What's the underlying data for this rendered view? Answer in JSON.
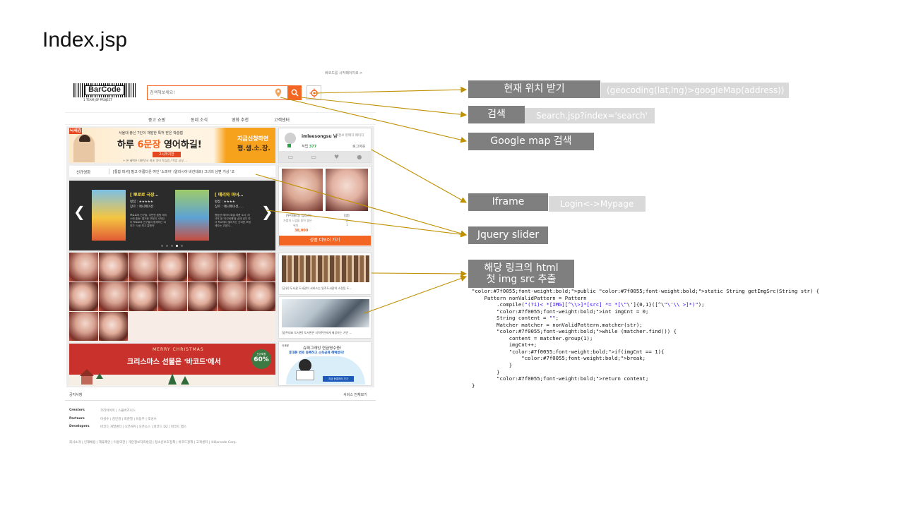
{
  "slide": {
    "title": "Index.jsp"
  },
  "mockup": {
    "top_link": "바코드를 시작페이지로 >",
    "logo": {
      "text": "BarCode",
      "sub": "1 TEAM JSP PROJECT"
    },
    "search": {
      "placeholder": "검색해보세요!"
    },
    "nav": [
      "중고 쇼핑",
      "동네 소식",
      "영화 추천",
      "고객센터"
    ],
    "banner1": {
      "tag": "뇌새김",
      "top_line": "서울대 출신 7인이 개발한 특허 받은 학습법",
      "main1": "하루",
      "main_highlight": "6문장",
      "main2": "영어하길!",
      "sub_btn": "2시까지만",
      "note": "+ 본 혜택은 대한민국 최초 영어 학습법 / 학업 공부 ...",
      "right1": "지금신청하면",
      "right2": "평.생.소.장."
    },
    "login": {
      "user": "imleesongsu 님",
      "links": "내정보  판매자 페이지",
      "points_label": "적립",
      "points": "377",
      "logout": "로그아웃"
    },
    "ticker": {
      "label": "신규영화",
      "text": "[통합 피셔] 필고 아름다운 여인 '소피아' (알리시아 비칸데르) 그녀의 남편 거상 '코"
    },
    "slider": {
      "movies": [
        {
          "title": "[ 뽀로로 극장…",
          "rating": "평점 : ★★★★★",
          "genre": "장르 : 애니메이션",
          "desc": "뽀로로와 친구들, 이번엔 음원 레이스에 출동! 즐거운 모험이 시작된다 뽀로로와 친구들이 함께하는 이야기 '사상 최고 흥행작'"
        },
        {
          "title": "[ 메리와 마녀…",
          "rating": "평점 : ★★★★",
          "genre": "장르 : 애니메이션, …",
          "desc": "평범한 메리의 특별 여름 소녀, 마녀의 꽃 '야간비행'을 손에 넣다 마녀 학교에서 벌어지는 신비한 모험 메리는 고양이…"
        }
      ],
      "prev": "❮",
      "next": "❯"
    },
    "product": {
      "name": "[투이블러] 엄리샤]",
      "desc": "가볍지 느낌을 좋아 좋은",
      "meta": "위치",
      "price": "38,000",
      "right1": "[샘]",
      "right2": "빙",
      "right3": "1",
      "more": "상품 더보러 가기"
    },
    "news": [
      "[공유] 도서관 도서관이 서비스는 일주도서관의 소장된 도...",
      "[범주대표 도서관] 도서관은 지역주민에게 제공하는 기반 ..."
    ],
    "xmas": {
      "title": "MERRY CHRISTMAS",
      "main": "크리스마스 선물은 '바코드'에서",
      "badge_top": "신규회원",
      "badge": "60%"
    },
    "promo": {
      "line1": "슈퍼그래잉 현금영수증!",
      "line2": "휴대폰 번호 등록하고 소득공제 혜택받자!",
      "btn": "지금 등록하러 가기",
      "tag": "국세청"
    },
    "footer": {
      "notice": "공지사항",
      "service_all": "서비스 전체보기",
      "rows": [
        {
          "label": "Creators",
          "items": "코리아이미 | 스몰비즈니스"
        },
        {
          "label": "Partners",
          "items": "이성수 | 김민경 | 박준열 | 육동주 | 조성수"
        },
        {
          "label": "Developers",
          "items": "바코드 개발센터 | 오픈API | 오픈소스 | 바코드 D2 | 바코드 랩스"
        }
      ],
      "bottom": "회사소개 | 인재채용 | 제휴제안 | 이용약관 | 개인정보처리방침 | 청소년보호정책 | 바코드정책 | 고객센터 | ©Barcode Corp."
    }
  },
  "callouts": {
    "location": {
      "label": "현재 위치 받기",
      "detail": "(geocoding(lat,lng)>googleMap(address))"
    },
    "search": {
      "label": "검색",
      "detail": "Search.jsp?index='search'"
    },
    "gmap": {
      "label": "Google map 검색"
    },
    "iframe": {
      "label": "Iframe",
      "detail": "Login<->Mypage"
    },
    "jquery": {
      "label": "Jquery slider"
    },
    "img": {
      "line1": "해당 링크의 html",
      "line2": "첫 img src 추출"
    }
  },
  "code": [
    "public static String getImgSrc(String str) {",
    "    Pattern nonValidPattern = Pattern",
    "        .compile(\"(?i)< *[IMG][^\\\\>]*[src] *= *[\\\"\\']{0,1}([^\\\"\\'\\\\ >]*)\");",
    "        int imgCnt = 0;",
    "        String content = \"\";",
    "        Matcher matcher = nonValidPattern.matcher(str);",
    "        while (matcher.find()) {",
    "            content = matcher.group(1);",
    "            imgCnt++;",
    "            if(imgCnt == 1){",
    "                break;",
    "            }",
    "        }",
    "        return content;",
    "}"
  ],
  "colors": {
    "accent": "#f26522",
    "arrow": "#bf9000",
    "callout": "#7f7f7f",
    "detail": "#d9d9d9"
  }
}
